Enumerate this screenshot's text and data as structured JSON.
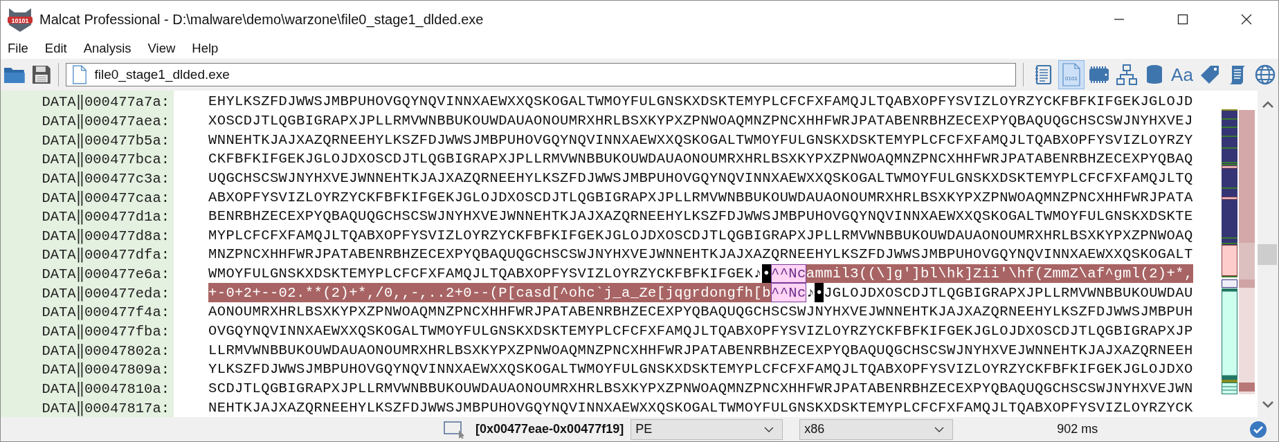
{
  "window": {
    "logo_text": "10101",
    "title": "Malcat Professional - D:\\malware\\demo\\warzone\\file0_stage1_dlded.exe"
  },
  "menu": [
    "File",
    "Edit",
    "Analysis",
    "View",
    "Help"
  ],
  "path_field": {
    "value": "file0_stage1_dlded.exe"
  },
  "tools": [
    {
      "kind": "notes",
      "selected": false
    },
    {
      "kind": "hex",
      "label": "0101",
      "selected": true
    },
    {
      "kind": "chip",
      "selected": false
    },
    {
      "kind": "tree",
      "selected": false
    },
    {
      "kind": "database",
      "selected": false
    },
    {
      "kind": "font",
      "label": "Aa",
      "selected": false
    },
    {
      "kind": "tag",
      "selected": false
    },
    {
      "kind": "scroll",
      "selected": false
    },
    {
      "kind": "globe",
      "selected": false
    }
  ],
  "rows": [
    {
      "segment": "DATA",
      "sep": "‖",
      "address": "000477a7a:",
      "parts": [
        {
          "kind": "plain",
          "text": "EHYLKSZFDJWWSJMBPUHOVGQYNQVINNXAEWXXQSKOGALTWMOYFULGNSKXDSKTEMYPLCFCFXFAMQJLTQABXOPFYSVIZLOYRZYCKFBFKIFGEKJGLOJD"
        }
      ]
    },
    {
      "segment": "DATA",
      "sep": "‖",
      "address": "000477aea:",
      "parts": [
        {
          "kind": "plain",
          "text": "XOSCDJTLQGBIGRAPXJPLLRMVWNBBUKOUWDAUAONOUMRXHRLBSXKYPXZPNWOAQMNZPNCXHHFWRJPATABENRBHZECEXPYQBAQUQGCHSCSWJNYHXVEJ"
        }
      ]
    },
    {
      "segment": "DATA",
      "sep": "‖",
      "address": "000477b5a:",
      "parts": [
        {
          "kind": "plain",
          "text": "WNNEHTKJAJXAZQRNEEHYLKSZFDJWWSJMBPUHOVGQYNQVINNXAEWXXQSKOGALTWMOYFULGNSKXDSKTEMYPLCFCFXFAMQJLTQABXOPFYSVIZLOYRZY"
        }
      ]
    },
    {
      "segment": "DATA",
      "sep": "‖",
      "address": "000477bca:",
      "parts": [
        {
          "kind": "plain",
          "text": "CKFBFKIFGEKJGLOJDXOSCDJTLQGBIGRAPXJPLLRMVWNBBUKOUWDAUAONOUMRXHRLBSXKYPXZPNWOAQMNZPNCXHHFWRJPATABENRBHZECEXPYQBAQ"
        }
      ]
    },
    {
      "segment": "DATA",
      "sep": "‖",
      "address": "000477c3a:",
      "parts": [
        {
          "kind": "plain",
          "text": "UQGCHSCSWJNYHXVEJWNNEHTKJAJXAZQRNEEHYLKSZFDJWWSJMBPUHOVGQYNQVINNXAEWXXQSKOGALTWMOYFULGNSKXDSKTEMYPLCFCFXFAMQJLTQ"
        }
      ]
    },
    {
      "segment": "DATA",
      "sep": "‖",
      "address": "000477caa:",
      "parts": [
        {
          "kind": "plain",
          "text": "ABXOPFYSVIZLOYRZYCKFBFKIFGEKJGLOJDXOSCDJTLQGBIGRAPXJPLLRMVWNBBUKOUWDAUAONOUMRXHRLBSXKYPXZPNWOAQMNZPNCXHHFWRJPATA"
        }
      ]
    },
    {
      "segment": "DATA",
      "sep": "‖",
      "address": "000477d1a:",
      "parts": [
        {
          "kind": "plain",
          "text": "BENRBHZECEXPYQBAQUQGCHSCSWJNYHXVEJWNNEHTKJAJXAZQRNEEHYLKSZFDJWWSJMBPUHOVGQYNQVINNXAEWXXQSKOGALTWMOYFULGNSKXDSKTE"
        }
      ]
    },
    {
      "segment": "DATA",
      "sep": "‖",
      "address": "000477d8a:",
      "parts": [
        {
          "kind": "plain",
          "text": "MYPLCFCFXFAMQJLTQABXOPFYSVIZLOYRZYCKFBFKIFGEKJGLOJDXOSCDJTLQGBIGRAPXJPLLRMVWNBBUKOUWDAUAONOUMRXHRLBSXKYPXZPNWOAQ"
        }
      ]
    },
    {
      "segment": "DATA",
      "sep": "‖",
      "address": "000477dfa:",
      "parts": [
        {
          "kind": "plain",
          "text": "MNZPNCXHHFWRJPATABENRBHZECEXPYQBAQUQGCHSCSWJNYHXVEJWNNEHTKJAJXAZQRNEEHYLKSZFDJWWSJMBPUHOVGQYNQVINNXAEWXXQSKOGALT"
        }
      ]
    },
    {
      "segment": "DATA",
      "sep": "‖",
      "address": "000477e6a:",
      "parts": [
        {
          "kind": "plain",
          "text": "WMOYFULGNSKXDSKTEMYPLCFCFXFAMQJLTQABXOPFYSVIZLOYRZYCKFBFKIFGEK♪"
        },
        {
          "kind": "control",
          "text": "•"
        },
        {
          "kind": "marker",
          "text": "^^Nc"
        },
        {
          "kind": "selected",
          "text": "ammil3((\\]g']bl\\hk]Zii'\\hf(ZmmZ\\af^gml(2)+*,"
        }
      ]
    },
    {
      "segment": "DATA",
      "sep": "‖",
      "address": "000477eda:",
      "parts": [
        {
          "kind": "selected",
          "text": "+-0+2+--02.**(2)+*,/0,,-,..2+0--(P[casd[^ohc`j_a_Ze[jqgrdongfh[b"
        },
        {
          "kind": "marker",
          "text": "^^Nc"
        },
        {
          "kind": "plain",
          "text": "♪"
        },
        {
          "kind": "control",
          "text": "•"
        },
        {
          "kind": "plain",
          "text": "JGLOJDXOSCDJTLQGBIGRAPXJPLLRMVWNBBUKOUWDAU"
        }
      ]
    },
    {
      "segment": "DATA",
      "sep": "‖",
      "address": "000477f4a:",
      "parts": [
        {
          "kind": "plain",
          "text": "AONOUMRXHRLBSXKYPXZPNWOAQMNZPNCXHHFWRJPATABENRBHZECEXPYQBAQUQGCHSCSWJNYHXVEJWNNEHTKJAJXAZQRNEEHYLKSZFDJWWSJMBPUH"
        }
      ]
    },
    {
      "segment": "DATA",
      "sep": "‖",
      "address": "000477fba:",
      "parts": [
        {
          "kind": "plain",
          "text": "OVGQYNQVINNXAEWXXQSKOGALTWMOYFULGNSKXDSKTEMYPLCFCFXFAMQJLTQABXOPFYSVIZLOYRZYCKFBFKIFGEKJGLOJDXOSCDJTLQGBIGRAPXJP"
        }
      ]
    },
    {
      "segment": "DATA",
      "sep": "‖",
      "address": "00047802a:",
      "parts": [
        {
          "kind": "plain",
          "text": "LLRMVWNBBUKOUWDAUAONOUMRXHRLBSXKYPXZPNWOAQMNZPNCXHHFWRJPATABENRBHZECEXPYQBAQUQGCHSCSWJNYHXVEJWNNEHTKJAJXAZQRNEEH"
        }
      ]
    },
    {
      "segment": "DATA",
      "sep": "‖",
      "address": "00047809a:",
      "parts": [
        {
          "kind": "plain",
          "text": "YLKSZFDJWWSJMBPUHOVGQYNQVINNXAEWXXQSKOGALTWMOYFULGNSKXDSKTEMYPLCFCFXFAMQJLTQABXOPFYSVIZLOYRZYCKFBFKIFGEKJGLOJDXO"
        }
      ]
    },
    {
      "segment": "DATA",
      "sep": "‖",
      "address": "00047810a:",
      "parts": [
        {
          "kind": "plain",
          "text": "SCDJTLQGBIGRAPXJPLLRMVWNBBUKOUWDAUAONOUMRXHRLBSXKYPXZPNWOAQMNZPNCXHHFWRJPATABENRBHZECEXPYQBAQUQGCHSCSWJNYHXVEJWN"
        }
      ]
    },
    {
      "segment": "DATA",
      "sep": "‖",
      "address": "00047817a:",
      "parts": [
        {
          "kind": "plain",
          "text": "NEHTKJAJXAZQRNEEHYLKSZFDJWWSJMBPUHOVGQYNQVINNXAEWXXQSKOGALTWMOYFULGNSKXDSKTEMYPLCFCFXFAMQJLTQABXOPFYSVIZLOYRZYCK"
        }
      ]
    }
  ],
  "status_bar": {
    "range": "[0x00477eae-0x00477f19]",
    "format": "PE",
    "arch": "x86",
    "time": "902 ms"
  }
}
